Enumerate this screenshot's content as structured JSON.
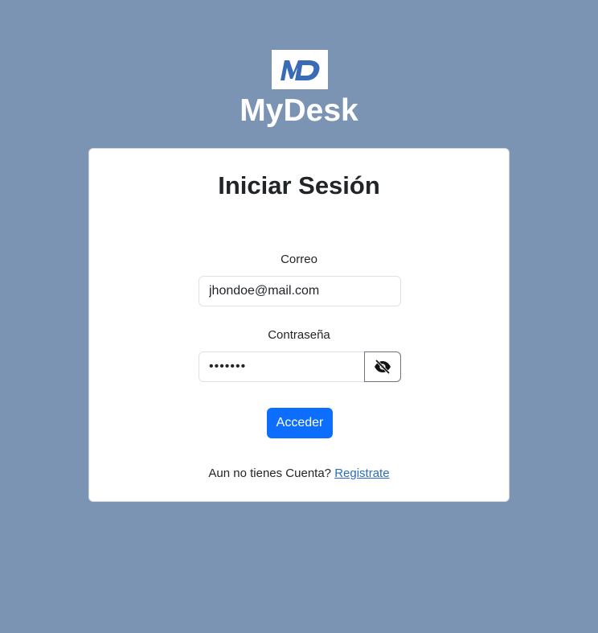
{
  "brand": {
    "logo_text": "MD",
    "app_name": "MyDesk",
    "logo_color": "#3a6bb7"
  },
  "login": {
    "title": "Iniciar Sesión",
    "email_label": "Correo",
    "email_value": "jhondoe@mail.com",
    "password_label": "Contraseña",
    "password_value": "1234567",
    "toggle_icon": "eye-slash-icon",
    "submit_label": "Acceder",
    "register_prompt": "Aun no tienes Cuenta?",
    "register_link": "Registrate"
  },
  "colors": {
    "background": "#7b94b4",
    "primary": "#0d6efd",
    "link": "#2b6cc4"
  }
}
